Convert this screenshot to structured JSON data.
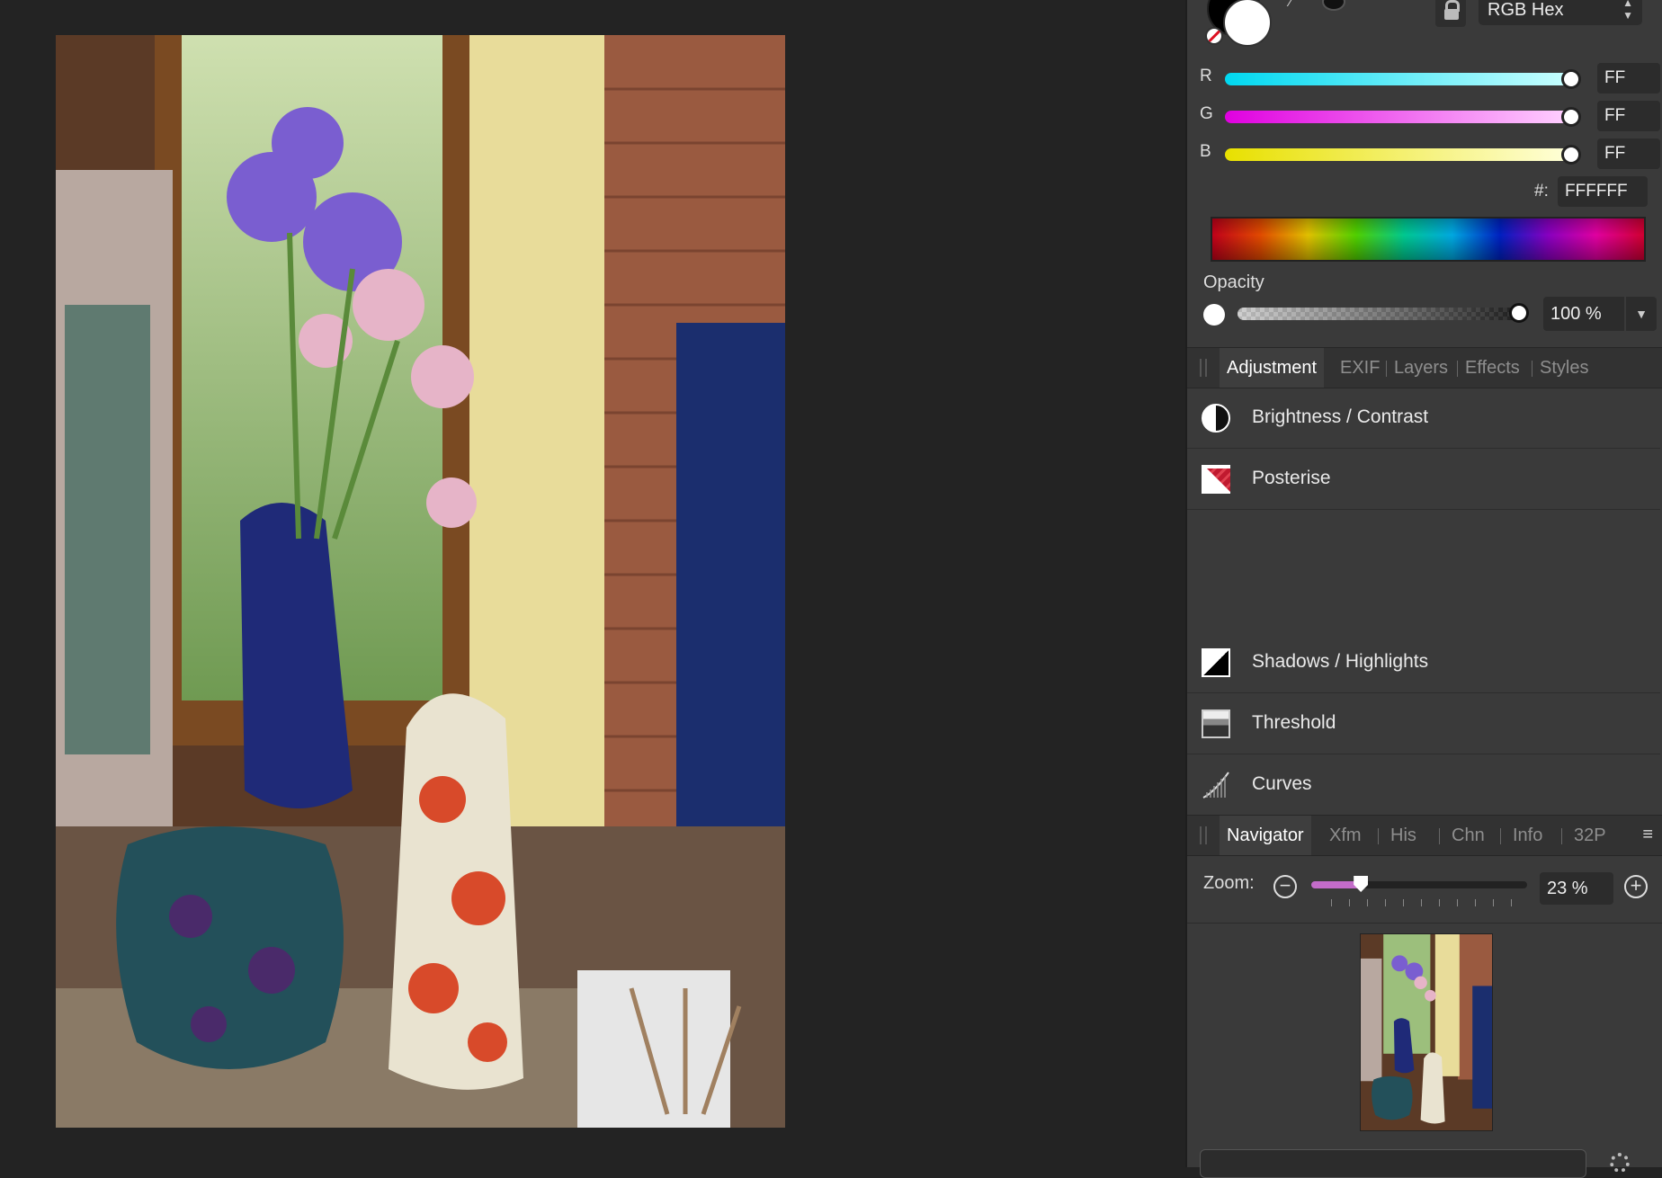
{
  "color": {
    "mode": "RGB Hex",
    "channels": [
      {
        "label": "R",
        "value": "FF",
        "color": "#00e5ff"
      },
      {
        "label": "G",
        "value": "FF",
        "color": "#ff00ff"
      },
      {
        "label": "B",
        "value": "FF",
        "color": "#ffff00"
      }
    ],
    "hex_label": "#:",
    "hex_value": "FFFFFF",
    "opacity_label": "Opacity",
    "opacity_value": "100 %"
  },
  "studio_tabs": [
    "Adjustment",
    "EXIF",
    "Layers",
    "Effects",
    "Styles"
  ],
  "adjustments": [
    {
      "label": "Brightness / Contrast",
      "icon": "brightness-contrast-icon"
    },
    {
      "label": "Posterise",
      "icon": "posterise-icon"
    },
    {
      "label": "Shadows / Highlights",
      "icon": "shadows-highlights-icon"
    },
    {
      "label": "Threshold",
      "icon": "threshold-icon"
    },
    {
      "label": "Curves",
      "icon": "curves-icon"
    }
  ],
  "navigator_tabs": [
    "Navigator",
    "Xfm",
    "His",
    "Chn",
    "Info",
    "32P"
  ],
  "navigator": {
    "zoom_label": "Zoom:",
    "zoom_value": "23 %",
    "zoom_fraction": 0.23
  },
  "colors": {
    "panel_bg": "#3a3a3a",
    "canvas_bg": "#232323",
    "accent": "#c36cc9"
  }
}
